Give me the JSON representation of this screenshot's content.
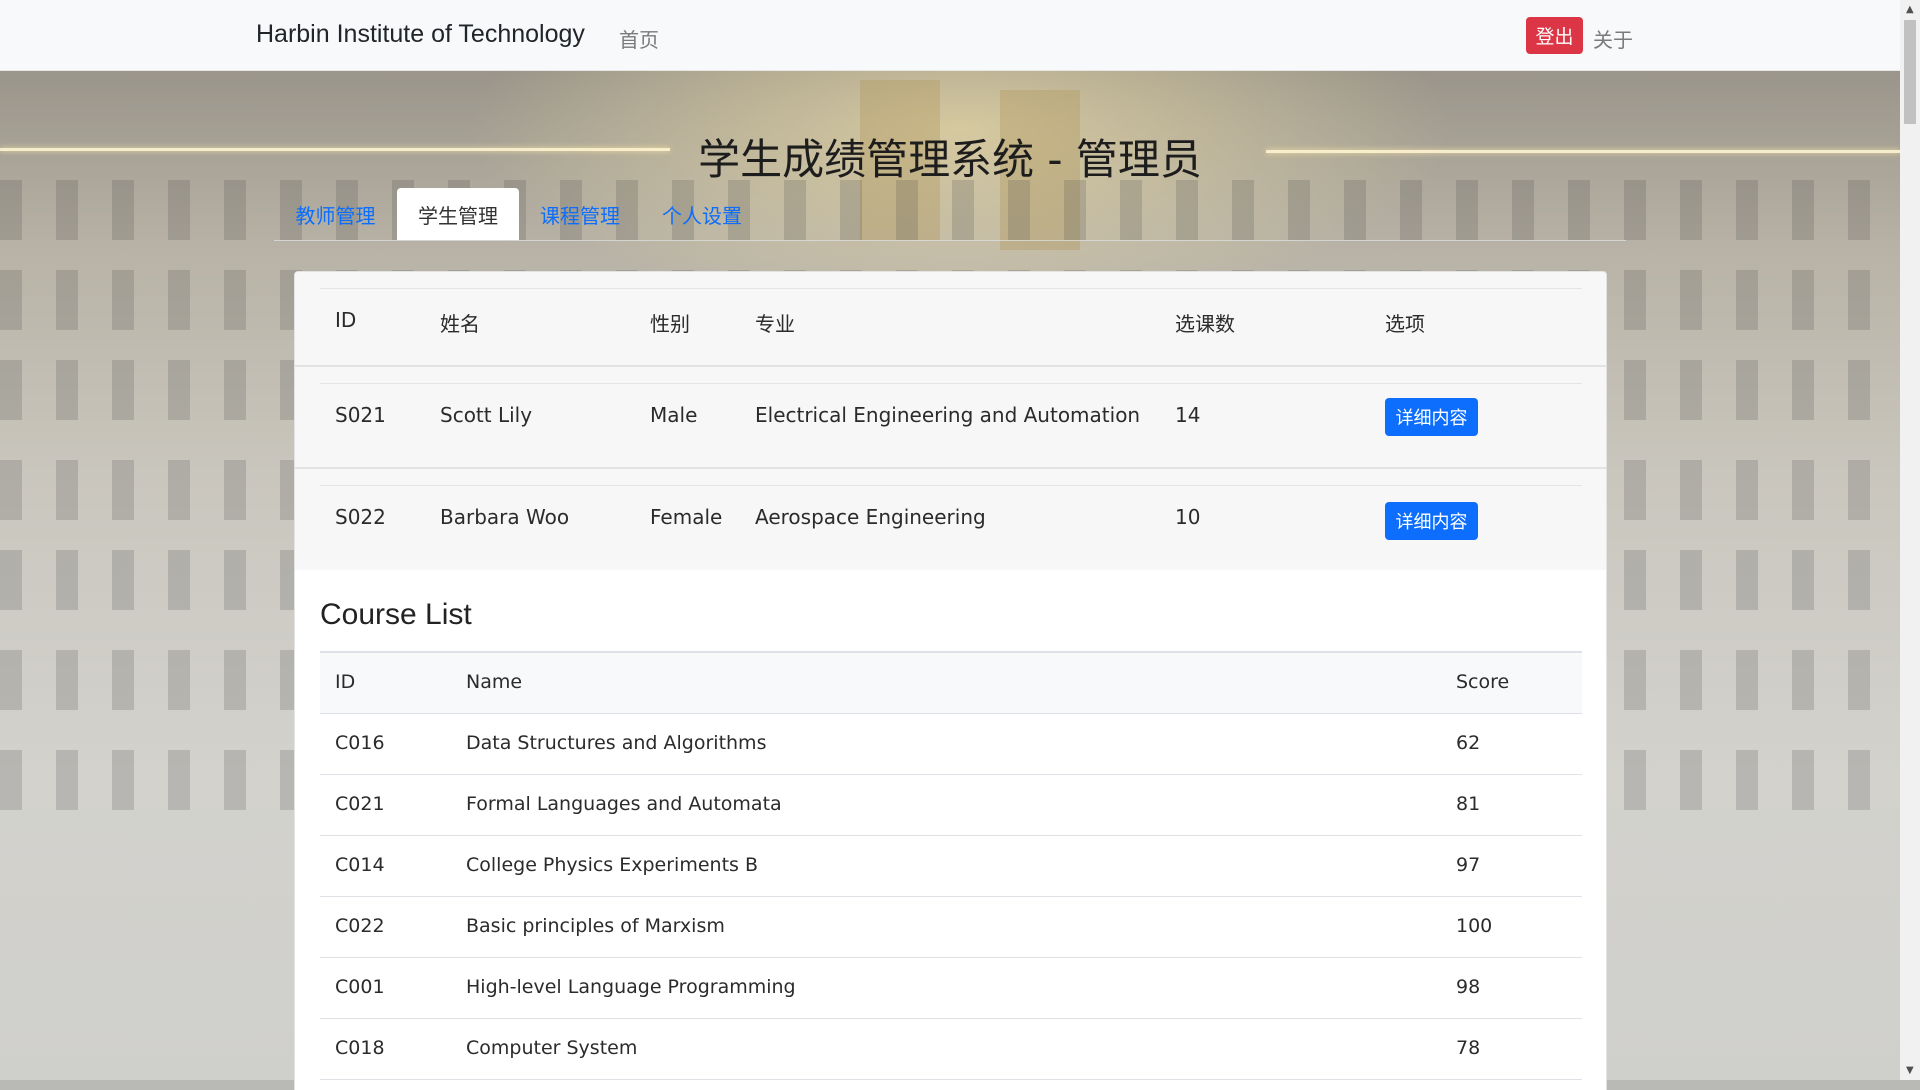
{
  "navbar": {
    "brand": "Harbin Institute of Technology",
    "home": "首页",
    "logout": "登出",
    "about": "关于"
  },
  "page_title": "学生成绩管理系统 - 管理员",
  "tabs": [
    {
      "label": "教师管理",
      "active": false
    },
    {
      "label": "学生管理",
      "active": true
    },
    {
      "label": "课程管理",
      "active": false
    },
    {
      "label": "个人设置",
      "active": false
    }
  ],
  "student_table": {
    "headers": {
      "id": "ID",
      "name": "姓名",
      "gender": "性别",
      "major": "专业",
      "course_count": "选课数",
      "options": "选项"
    },
    "rows": [
      {
        "id": "S021",
        "name": "Scott Lily",
        "gender": "Male",
        "major": "Electrical Engineering and Automation",
        "course_count": "14",
        "button": "详细内容"
      },
      {
        "id": "S022",
        "name": "Barbara Woo",
        "gender": "Female",
        "major": "Aerospace Engineering",
        "course_count": "10",
        "button": "详细内容"
      }
    ]
  },
  "course_list": {
    "title": "Course List",
    "headers": {
      "id": "ID",
      "name": "Name",
      "score": "Score"
    },
    "rows": [
      {
        "id": "C016",
        "name": "Data Structures and Algorithms",
        "score": "62"
      },
      {
        "id": "C021",
        "name": "Formal Languages and Automata",
        "score": "81"
      },
      {
        "id": "C014",
        "name": "College Physics Experiments B",
        "score": "97"
      },
      {
        "id": "C022",
        "name": "Basic principles of Marxism",
        "score": "100"
      },
      {
        "id": "C001",
        "name": "High-level Language Programming",
        "score": "98"
      },
      {
        "id": "C018",
        "name": "Computer System",
        "score": "78"
      }
    ]
  },
  "colors": {
    "primary": "#0d6efd",
    "danger": "#dc3545",
    "navbar_bg": "#f8f9fa"
  }
}
